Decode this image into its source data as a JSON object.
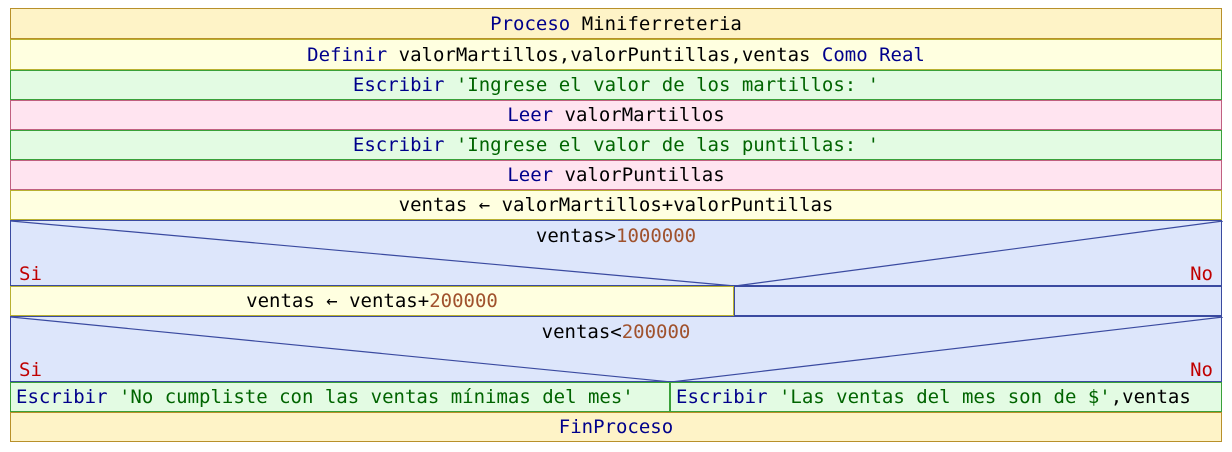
{
  "header": {
    "kw": "Proceso",
    "name": "Miniferreteria"
  },
  "define": {
    "kw": "Definir",
    "vars": "valorMartillos,valorPuntillas,ventas",
    "kw2": "Como Real"
  },
  "write1": {
    "kw": "Escribir",
    "str": "'Ingrese el valor de los martillos: '"
  },
  "read1": {
    "kw": "Leer",
    "var": "valorMartillos"
  },
  "write2": {
    "kw": "Escribir",
    "str": "'Ingrese el valor de las puntillas: '"
  },
  "read2": {
    "kw": "Leer",
    "var": "valorPuntillas"
  },
  "assign1": {
    "text": "ventas ← valorMartillos+valorPuntillas"
  },
  "cond1": {
    "expr": "ventas>",
    "num": "1000000",
    "yes": "Si",
    "no": "No"
  },
  "assign2": {
    "text": "ventas ← ventas+",
    "num": "200000"
  },
  "cond2": {
    "expr": "ventas<",
    "num": "200000",
    "yes": "Si",
    "no": "No"
  },
  "write3": {
    "kw": "Escribir",
    "str": "'No cumpliste con las ventas mínimas del mes'"
  },
  "write4": {
    "kw": "Escribir",
    "str": "'Las ventas del mes son de $'",
    "tail": ",ventas"
  },
  "footer": {
    "kw": "FinProceso"
  }
}
